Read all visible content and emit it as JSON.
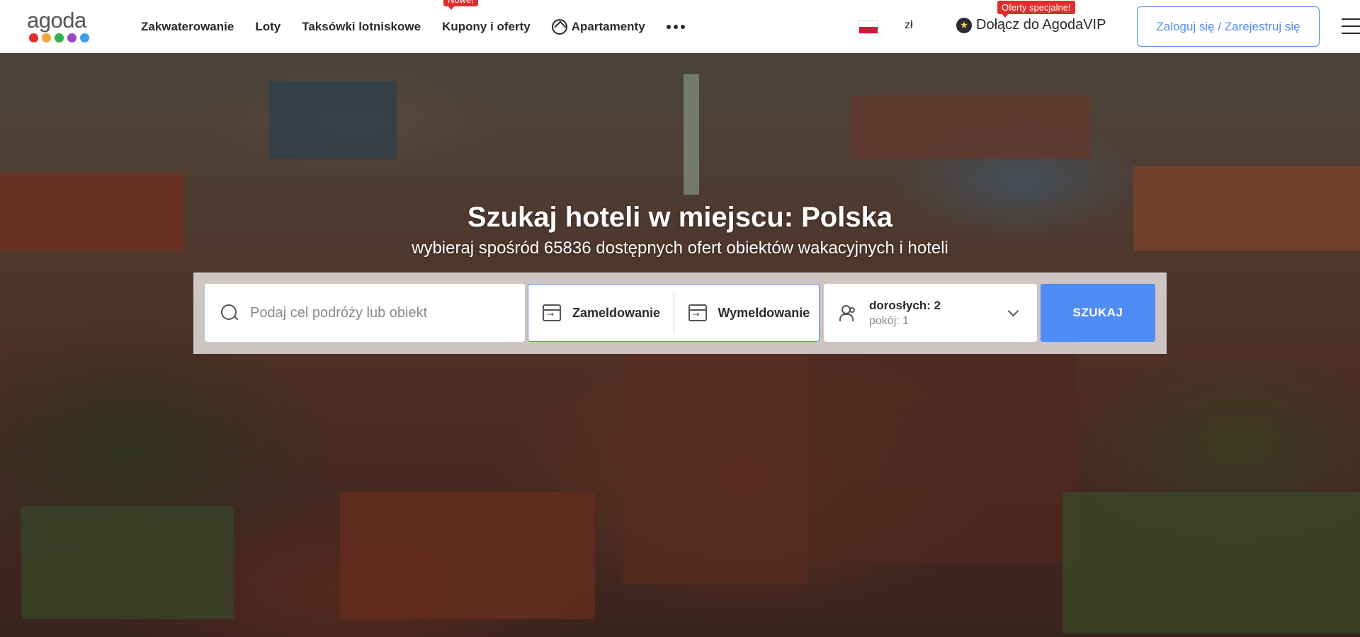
{
  "logo": {
    "text": "agoda",
    "dot_colors": [
      "#e12d2d",
      "#f2a73b",
      "#2bb24c",
      "#9b49c9",
      "#3b9cf0"
    ]
  },
  "nav": {
    "items": [
      {
        "label": "Zakwaterowanie"
      },
      {
        "label": "Loty"
      },
      {
        "label": "Taksówki lotniskowe"
      },
      {
        "label": "Kupony i oferty",
        "badge": "Nowe!"
      },
      {
        "label": "Apartamenty",
        "icon": "home-icon"
      }
    ],
    "more_icon": "more-dots-icon"
  },
  "locale": {
    "flag": "poland-flag-icon",
    "currency": "zł"
  },
  "vip": {
    "label": "Dołącz do AgodaVIP",
    "badge": "Oferty specjalne!",
    "icon": "vip-star-icon"
  },
  "auth": {
    "login_label": "Zaloguj się / Zarejestruj się"
  },
  "menu_icon": "hamburger-menu-icon",
  "hero": {
    "title": "Szukaj hoteli w miejscu: Polska",
    "subtitle": "wybieraj spośród 65836 dostępnych ofert obiektów wakacyjnych i hoteli"
  },
  "search": {
    "destination_placeholder": "Podaj cel podróży lub obiekt",
    "destination_value": "",
    "checkin_label": "Zameldowanie",
    "checkout_label": "Wymeldowanie",
    "adults_label": "dorosłych: 2",
    "rooms_label": "pokój: 1",
    "submit_label": "SZUKAJ"
  },
  "colors": {
    "accent": "#4f8cf5",
    "badge_red": "#e12d2d"
  }
}
